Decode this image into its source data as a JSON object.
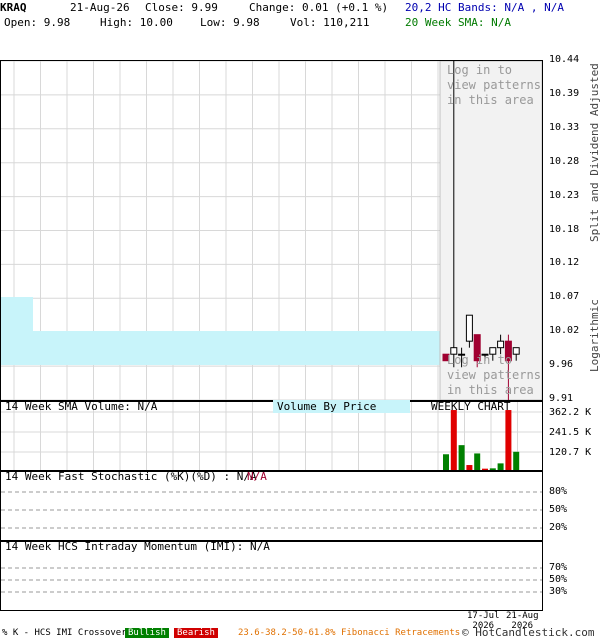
{
  "header": {
    "symbol": "KRAQ",
    "date": "21-Aug-26",
    "close": "Close: 9.99",
    "change": "Change: 0.01 (+0.1 %)",
    "open": "Open: 9.98",
    "high": "High: 10.00",
    "low": "Low: 9.98",
    "vol": "Vol: 110,211",
    "hc_bands": "20,2 HC Bands: N/A , N/A",
    "sma20": "20 Week SMA: N/A"
  },
  "main_panel": {
    "pattern_msg_line1": "Log in to",
    "pattern_msg_line2": "view patterns",
    "pattern_msg_line3": "in this area",
    "side_label": "Split and Dividend Adjusted",
    "log_label": "Logarithmic",
    "price_ticks": [
      "10.44",
      "10.39",
      "10.33",
      "10.28",
      "10.23",
      "10.18",
      "10.12",
      "10.07",
      "10.02",
      "9.96",
      "9.91"
    ]
  },
  "volume_panel": {
    "title": "14 Week SMA Volume: N/A",
    "vbp_label": "Volume By Price",
    "chart_type_label": "WEEKLY CHART",
    "ticks": [
      "362.2 K",
      "241.5 K",
      "120.7 K"
    ]
  },
  "stoch_panel": {
    "title": "14 Week Fast Stochastic (%K)(%D) : N/A",
    "title_na": "N/A",
    "ticks": [
      "80%",
      "50%",
      "20%"
    ]
  },
  "imi_panel": {
    "title": "14 Week HCS Intraday Momentum (IMI): N/A",
    "ticks": [
      "70%",
      "50%",
      "30%"
    ]
  },
  "x_labels": [
    {
      "line1": "17-Jul",
      "line2": "2026"
    },
    {
      "line1": "21-Aug",
      "line2": "2026"
    }
  ],
  "footer": {
    "crossover": "% K - HCS IMI Crossover,",
    "bullish": "Bullish",
    "bearish": "Bearish",
    "fib": "23.6-38.2-50-61.8% Fibonacci Retracements",
    "copyright": "© HotCandlestick.com"
  },
  "colors": {
    "up": "#008000",
    "down": "#a00030",
    "band": "#c8f4fa",
    "shade": "#f2f2f2",
    "vbp": "#c8f4fa"
  },
  "chart_data": {
    "type": "candlestick",
    "price_scale": "logarithmic",
    "ylim": [
      9.91,
      10.44
    ],
    "candles": [
      {
        "open": 9.98,
        "high": 9.98,
        "low": 9.97,
        "close": 9.97
      },
      {
        "open": 9.98,
        "high": 10.44,
        "low": 9.96,
        "close": 9.99
      },
      {
        "open": 9.98,
        "high": 9.99,
        "low": 9.96,
        "close": 9.98
      },
      {
        "open": 10.0,
        "high": 10.04,
        "low": 9.99,
        "close": 10.04
      },
      {
        "open": 10.01,
        "high": 10.01,
        "low": 9.96,
        "close": 9.97
      },
      {
        "open": 9.98,
        "high": 9.98,
        "low": 9.97,
        "close": 9.98
      },
      {
        "open": 9.98,
        "high": 9.99,
        "low": 9.97,
        "close": 9.99
      },
      {
        "open": 9.99,
        "high": 10.01,
        "low": 9.98,
        "close": 10.0
      },
      {
        "open": 10.0,
        "high": 10.01,
        "low": 9.9,
        "close": 9.97
      },
      {
        "open": 9.98,
        "high": 9.99,
        "low": 9.97,
        "close": 9.99
      }
    ],
    "volume_ylim": [
      0,
      362200
    ],
    "volumes": [
      {
        "value": 95000,
        "dir": "up"
      },
      {
        "value": 362000,
        "dir": "down"
      },
      {
        "value": 150000,
        "dir": "up"
      },
      {
        "value": 30000,
        "dir": "down"
      },
      {
        "value": 100000,
        "dir": "up"
      },
      {
        "value": 8000,
        "dir": "down"
      },
      {
        "value": 10000,
        "dir": "up"
      },
      {
        "value": 40000,
        "dir": "up"
      },
      {
        "value": 362000,
        "dir": "down"
      },
      {
        "value": 110000,
        "dir": "up"
      }
    ]
  }
}
